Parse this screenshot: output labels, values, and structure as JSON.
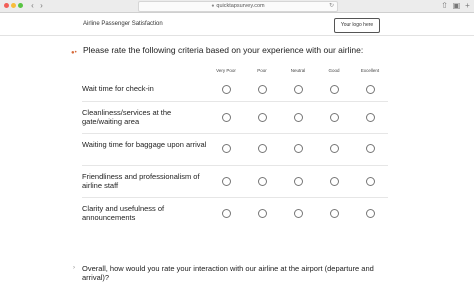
{
  "browser": {
    "url": "quicktapsurvey.com"
  },
  "header": {
    "survey_title": "Airline Passenger Satisfaction",
    "logo_text": "Your logo here"
  },
  "question1": {
    "text": "Please rate the following criteria based on your experience with our airline:",
    "columns": [
      "Very Poor",
      "Poor",
      "Neutral",
      "Good",
      "Excellent"
    ],
    "rows": [
      "Wait time for check-in",
      "Cleanliness/services at the gate/waiting area",
      "Waiting time for baggage upon arrival",
      "Friendliness and professionalism of airline staff",
      "Clarity and usefulness of announcements"
    ]
  },
  "question2": {
    "text": "Overall, how would you rate your interaction with our airline at the airport (departure and arrival)?"
  }
}
